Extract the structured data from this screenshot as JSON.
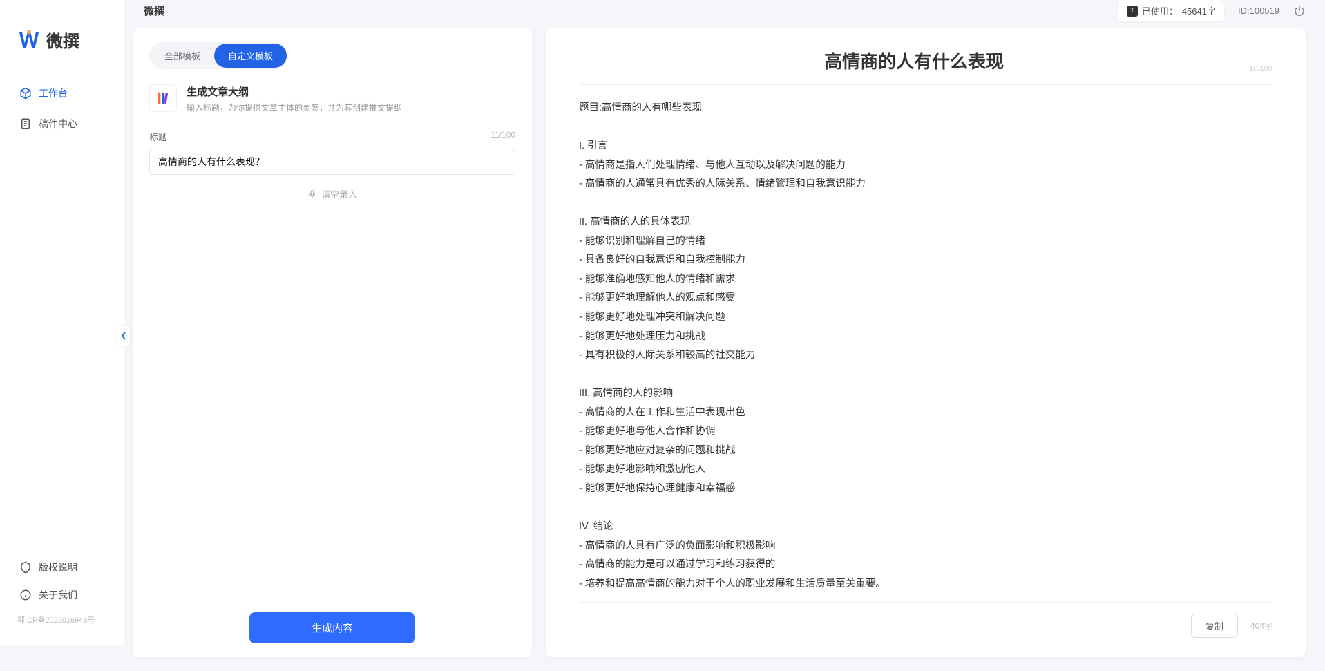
{
  "app": {
    "name": "微撰"
  },
  "sidebar": {
    "logo_text": "微撰",
    "nav": [
      {
        "label": "工作台",
        "active": true,
        "icon": "cube-icon"
      },
      {
        "label": "稿件中心",
        "active": false,
        "icon": "doc-icon"
      }
    ],
    "bottom": [
      {
        "label": "版权说明",
        "icon": "shield-icon"
      },
      {
        "label": "关于我们",
        "icon": "info-icon"
      }
    ],
    "icp": "鄂ICP备2022016946号"
  },
  "header": {
    "usage_label": "已使用：",
    "usage_value": "45641字",
    "user_id_label": "ID:",
    "user_id": "100519"
  },
  "left": {
    "tabs": [
      {
        "label": "全部模板",
        "active": false
      },
      {
        "label": "自定义模板",
        "active": true
      }
    ],
    "template": {
      "title": "生成文章大纲",
      "desc": "输入标题，为你提供文章主体的灵感，并为其创建推文提纲"
    },
    "title_field": {
      "label": "标题",
      "count": "11/100",
      "value": "高情商的人有什么表现？"
    },
    "speech_label": "请空录入",
    "generate_label": "生成内容"
  },
  "right": {
    "title": "高情商的人有什么表现",
    "title_count": "10/100",
    "body": "题目:高情商的人有哪些表现\n\nI. 引言\n- 高情商是指人们处理情绪、与他人互动以及解决问题的能力\n- 高情商的人通常具有优秀的人际关系、情绪管理和自我意识能力\n\nII. 高情商的人的具体表现\n- 能够识别和理解自己的情绪\n- 具备良好的自我意识和自我控制能力\n- 能够准确地感知他人的情绪和需求\n- 能够更好地理解他人的观点和感受\n- 能够更好地处理冲突和解决问题\n- 能够更好地处理压力和挑战\n- 具有积极的人际关系和较高的社交能力\n\nIII. 高情商的人的影响\n- 高情商的人在工作和生活中表现出色\n- 能够更好地与他人合作和协调\n- 能够更好地应对复杂的问题和挑战\n- 能够更好地影响和激励他人\n- 能够更好地保持心理健康和幸福感\n\nIV. 结论\n- 高情商的人具有广泛的负面影响和积极影响\n- 高情商的能力是可以通过学习和练习获得的\n- 培养和提高高情商的能力对于个人的职业发展和生活质量至关重要。",
    "copy_label": "复制",
    "word_count": "404字"
  }
}
